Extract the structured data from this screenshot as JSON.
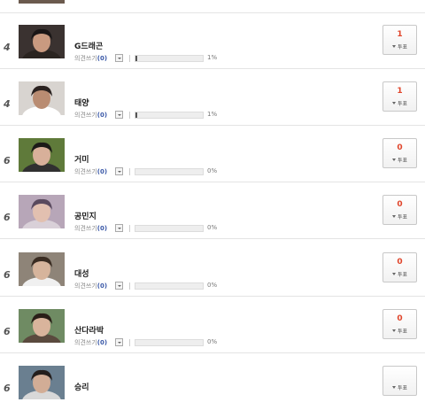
{
  "comment_label": "의견쓰기",
  "vote_label": "투표",
  "rows": [
    {
      "rank": "4",
      "name": "G드래곤",
      "comments": "0",
      "percent": "1%",
      "share": 0.01,
      "votes": "1"
    },
    {
      "rank": "4",
      "name": "태양",
      "comments": "0",
      "percent": "1%",
      "share": 0.01,
      "votes": "1"
    },
    {
      "rank": "6",
      "name": "거미",
      "comments": "0",
      "percent": "0%",
      "share": 0,
      "votes": "0"
    },
    {
      "rank": "6",
      "name": "공민지",
      "comments": "0",
      "percent": "0%",
      "share": 0,
      "votes": "0"
    },
    {
      "rank": "6",
      "name": "대성",
      "comments": "0",
      "percent": "0%",
      "share": 0,
      "votes": "0"
    },
    {
      "rank": "6",
      "name": "산다라박",
      "comments": "0",
      "percent": "0%",
      "share": 0,
      "votes": "0"
    },
    {
      "rank": "6",
      "name": "승리",
      "comments": "",
      "percent": "",
      "share": 0,
      "votes": ""
    }
  ],
  "colors": {
    "vote_count": "#e0452b",
    "comment_count": "#3b59a8"
  }
}
